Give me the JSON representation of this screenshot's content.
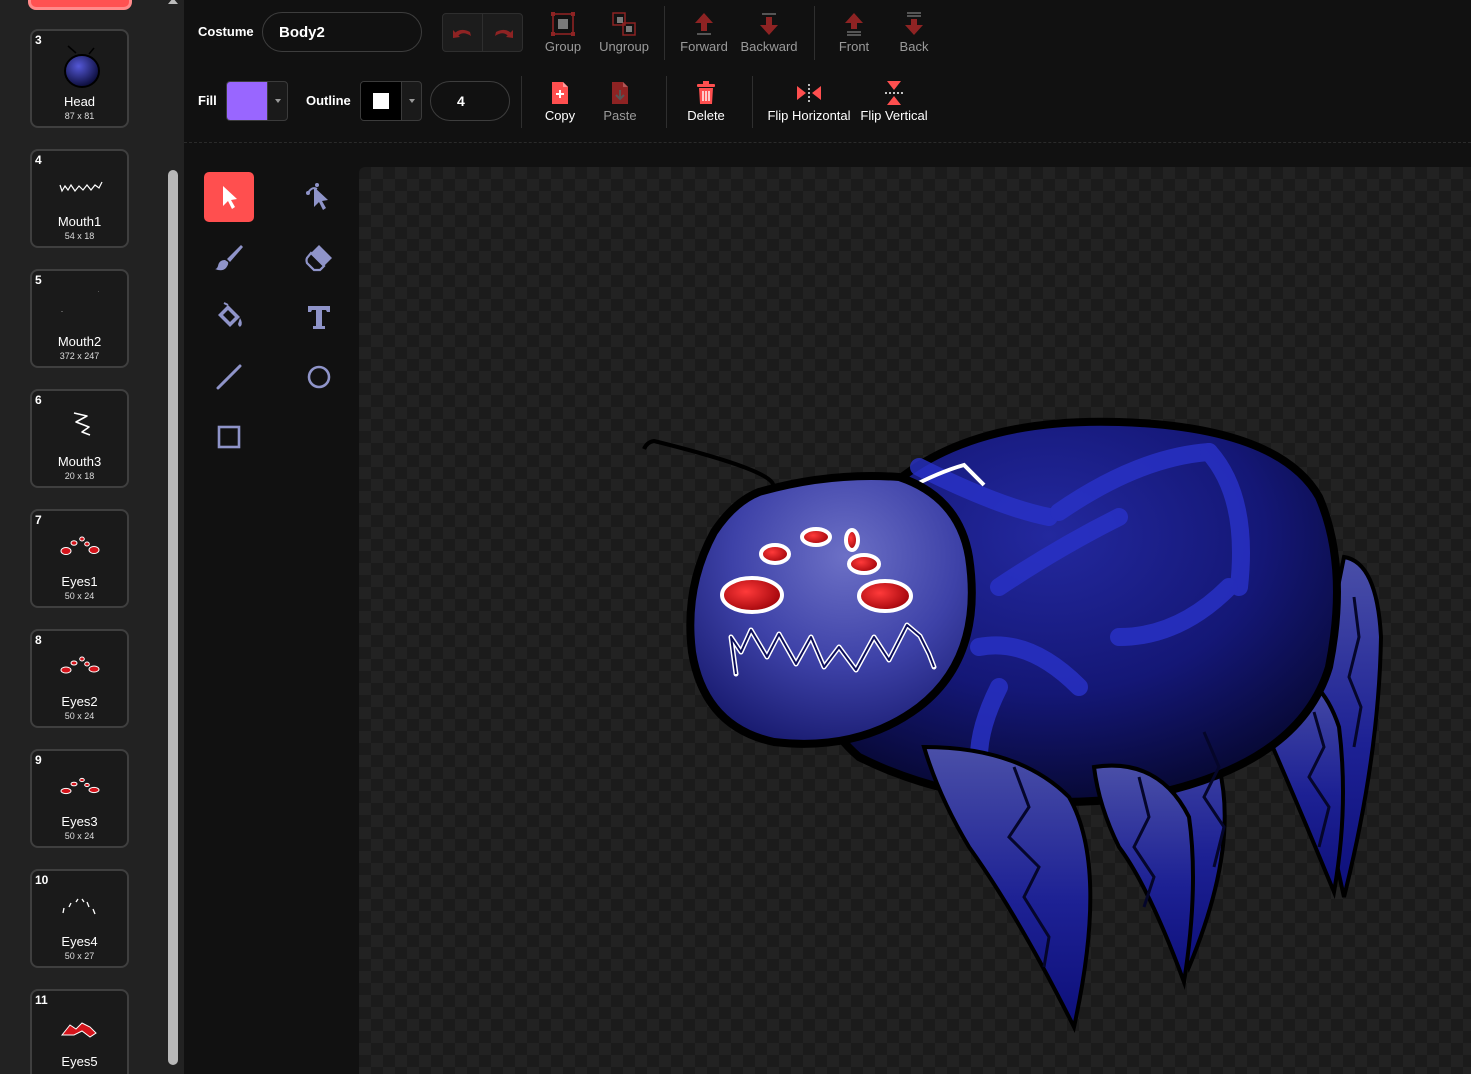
{
  "costume_list": [
    {
      "number": "3",
      "name": "Head",
      "size": "87 x 81"
    },
    {
      "number": "4",
      "name": "Mouth1",
      "size": "54 x 18"
    },
    {
      "number": "5",
      "name": "Mouth2",
      "size": "372 x 247"
    },
    {
      "number": "6",
      "name": "Mouth3",
      "size": "20 x 18"
    },
    {
      "number": "7",
      "name": "Eyes1",
      "size": "50 x 24"
    },
    {
      "number": "8",
      "name": "Eyes2",
      "size": "50 x 24"
    },
    {
      "number": "9",
      "name": "Eyes3",
      "size": "50 x 24"
    },
    {
      "number": "10",
      "name": "Eyes4",
      "size": "50 x 27"
    },
    {
      "number": "11",
      "name": "Eyes5",
      "size": ""
    }
  ],
  "toolbar": {
    "costume_label": "Costume",
    "costume_name": "Body2",
    "group_label": "Group",
    "ungroup_label": "Ungroup",
    "forward_label": "Forward",
    "backward_label": "Backward",
    "front_label": "Front",
    "back_label": "Back",
    "fill_label": "Fill",
    "outline_label": "Outline",
    "outline_width": "4",
    "copy_label": "Copy",
    "paste_label": "Paste",
    "delete_label": "Delete",
    "flip_horizontal_label": "Flip Horizontal",
    "flip_vertical_label": "Flip Vertical"
  },
  "colors": {
    "accent": "#ff4f4f",
    "fill_color": "#9966ff",
    "outline_color": "#ffffff",
    "spider_body": "#1c1f8c",
    "spider_eye": "#d4141b"
  },
  "tools": [
    {
      "name": "select",
      "icon": "arrow-icon",
      "active": true
    },
    {
      "name": "reshape",
      "icon": "reshape-icon",
      "active": false
    },
    {
      "name": "brush",
      "icon": "brush-icon",
      "active": false
    },
    {
      "name": "eraser",
      "icon": "eraser-icon",
      "active": false
    },
    {
      "name": "fill",
      "icon": "paint-bucket-icon",
      "active": false
    },
    {
      "name": "text",
      "icon": "text-icon",
      "active": false
    },
    {
      "name": "line",
      "icon": "line-icon",
      "active": false
    },
    {
      "name": "circle",
      "icon": "circle-icon",
      "active": false
    },
    {
      "name": "rectangle",
      "icon": "rectangle-icon",
      "active": false
    }
  ]
}
